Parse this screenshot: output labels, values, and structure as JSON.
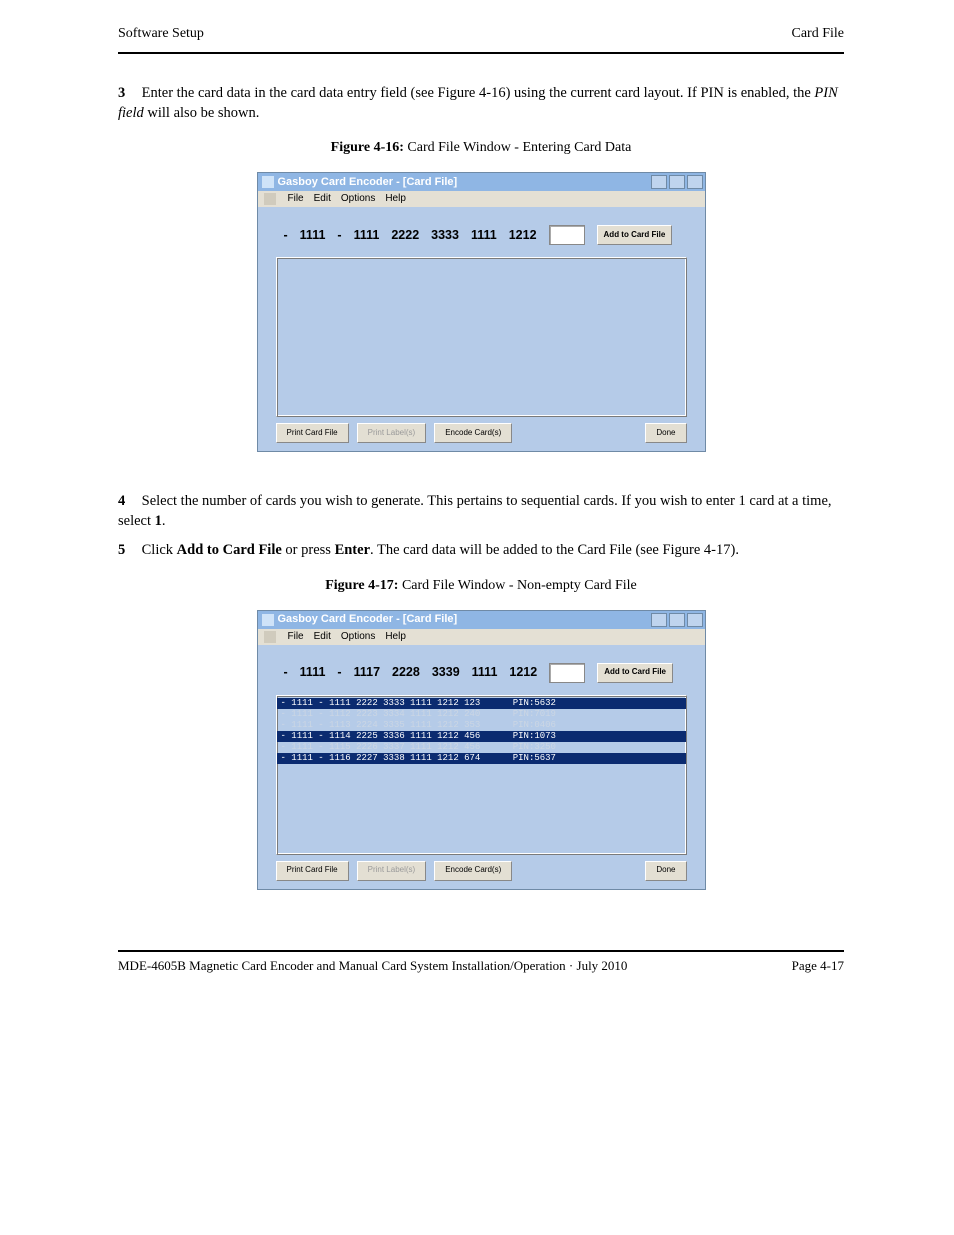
{
  "header": {
    "left": "Software Setup",
    "right": "Card File"
  },
  "steps": {
    "s3": {
      "num": "3",
      "text_pre": "Enter the card data in the card data entry field (see Figure 4-16) using the current card layout. If PIN is enabled, the ",
      "text_ital": "PIN field",
      "text_post": " will also be shown."
    },
    "s4": {
      "num": "4",
      "text_pre": "Select the number of cards you wish to generate. This pertains to sequential cards. If you wish to enter 1 card at a time, select ",
      "text_bold": "1",
      "text_post": "."
    },
    "s5": {
      "num": "5",
      "text_pre": "Click ",
      "text_bold": "Add to Card File",
      "text_mid": " or press ",
      "text_bold2": "Enter",
      "text_post": ". The card data will be added to the Card File (see Figure 4-17)."
    }
  },
  "figures": {
    "f16": {
      "label_b": "Figure 4-16:",
      "label_t": " Card File Window - Entering Card Data"
    },
    "f17": {
      "label_b": "Figure 4-17:",
      "label_t": " Card File Window - Non-empty Card File"
    }
  },
  "app": {
    "title": "Gasboy Card Encoder - [Card File]",
    "menu": {
      "file": "File",
      "edit": "Edit",
      "options": "Options",
      "help": "Help"
    },
    "buttons": {
      "print_card_file": "Print Card File",
      "print_labels": "Print Label(s)",
      "encode_cards": "Encode Card(s)",
      "done": "Done",
      "add": "Add to Card File"
    }
  },
  "screenshot1": {
    "card_segments": [
      "-",
      "1111",
      "-",
      "1111",
      "2222",
      "3333",
      "1111",
      "1212"
    ]
  },
  "screenshot2": {
    "card_segments": [
      "-",
      "1111",
      "-",
      "1117",
      "2228",
      "3339",
      "1111",
      "1212"
    ],
    "rows": [
      {
        "text": "- 1111 - 1111 2222 3333 1111 1212 123      PIN:5632",
        "sel": true
      },
      {
        "text": "- 1111 - 1112 2223 3334 1111 1212 240      PIN:7019",
        "sel": false
      },
      {
        "text": "- 1111 - 1113 2224 3335 1111 1212 353      PIN:0406",
        "sel": false
      },
      {
        "text": "- 1111 - 1114 2225 3336 1111 1212 456      PIN:1073",
        "sel": true
      },
      {
        "text": "- 1111 - 1115 2226 3337 1111 1212 456      PIN:3250",
        "sel": false
      },
      {
        "text": "- 1111 - 1116 2227 3338 1111 1212 674      PIN:5637",
        "sel": true
      }
    ]
  },
  "footer": {
    "left": "MDE-4605B Magnetic Card Encoder and Manual Card System Installation/Operation · July 2010",
    "right": "Page 4-17"
  }
}
